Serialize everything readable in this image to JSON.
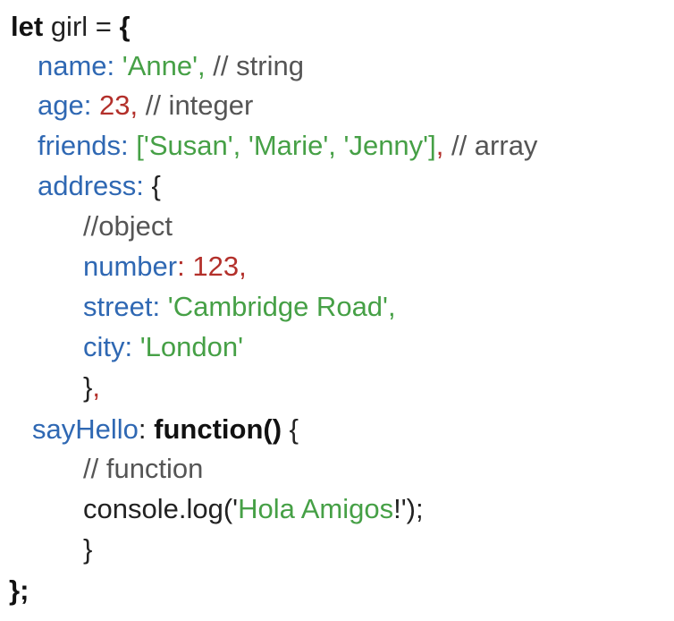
{
  "code": {
    "l1": {
      "kw": "let",
      "ident": "girl",
      "eq": "=",
      "brace": "{"
    },
    "l2": {
      "key": "name",
      "colon": ":",
      "value": "'Anne'",
      "comma": ",",
      "comment": "// string"
    },
    "l3": {
      "key": "age",
      "colon": ":",
      "value": "23",
      "comma": ",",
      "comment": "// integer"
    },
    "l4": {
      "key": "friends",
      "colon": ":",
      "open": "[",
      "v1": "'Susan'",
      "sep1": ",",
      "v2": "'Marie'",
      "sep2": ",",
      "v3": "'Jenny'",
      "close": "]",
      "comma": ",",
      "comment": "// array"
    },
    "l5": {
      "key": "address",
      "colon": ":",
      "brace": "{"
    },
    "l6": {
      "comment": "//object"
    },
    "l7": {
      "key": "number",
      "colon": ":",
      "value": "123",
      "comma": ","
    },
    "l8": {
      "key": "street",
      "colon": ":",
      "value": "'Cambridge Road'",
      "comma": ","
    },
    "l9": {
      "key": "city",
      "colon": ":",
      "value": "'London'"
    },
    "l10": {
      "brace": "}",
      "comma": ","
    },
    "l11": {
      "key": "sayHello",
      "colon": ":",
      "kw": "function()",
      "brace": "{"
    },
    "l12": {
      "comment": "// function"
    },
    "l13": {
      "prefix": "console.log(",
      "q1": "'",
      "str": "Hola Amigos",
      "bang": "!",
      "q2": "'",
      "suffix": ");"
    },
    "l14": {
      "brace": "}"
    },
    "l15": {
      "text": "};"
    }
  }
}
